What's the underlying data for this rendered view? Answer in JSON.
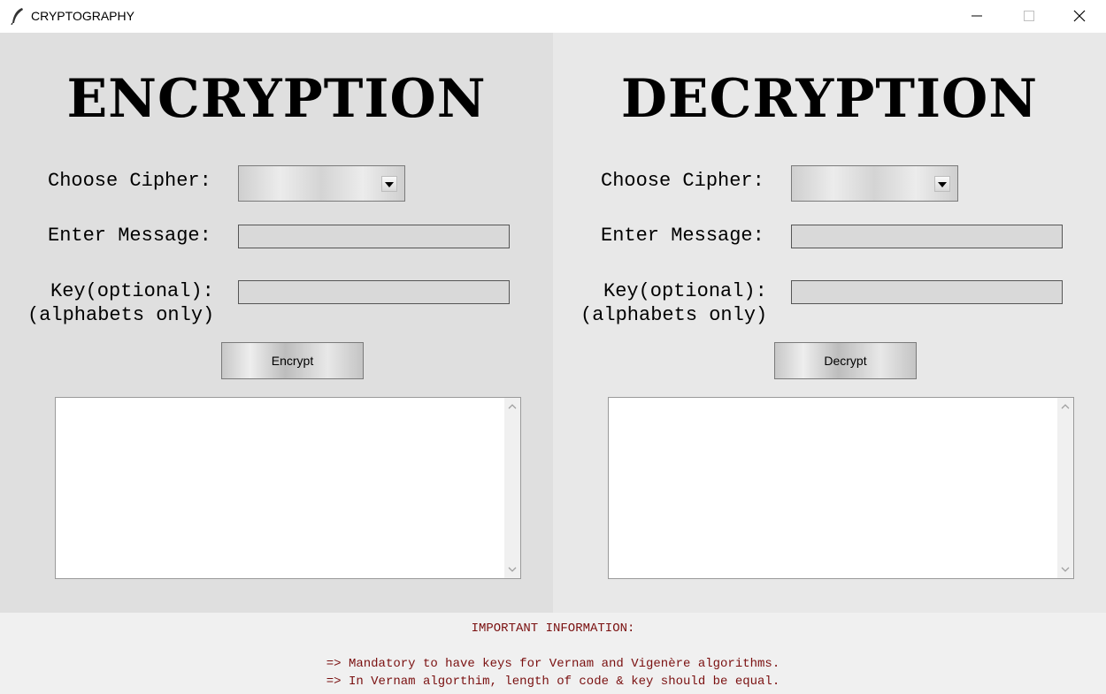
{
  "window": {
    "title": "CRYPTOGRAPHY",
    "icon": "feather-icon",
    "controls": [
      "minimize-icon",
      "maximize-icon",
      "close-icon"
    ]
  },
  "encryption": {
    "heading": "ENCRYPTION",
    "cipher_label": "Choose Cipher:",
    "cipher_value": "",
    "message_label": "Enter Message:",
    "message_value": "",
    "key_label": "Key(optional):",
    "key_hint": "(alphabets only)",
    "key_value": "",
    "button_label": "Encrypt",
    "output_text": ""
  },
  "decryption": {
    "heading": "DECRYPTION",
    "cipher_label": "Choose Cipher:",
    "cipher_value": "",
    "message_label": "Enter Message:",
    "message_value": "",
    "key_label": "Key(optional):",
    "key_hint": "(alphabets only)",
    "key_value": "",
    "button_label": "Decrypt",
    "output_text": ""
  },
  "info": {
    "title": "IMPORTANT INFORMATION:",
    "lines": [
      "=> Mandatory to have keys for Vernam and Vigenère algorithms.",
      "=> In Vernam algorthim, length of code & key should be equal."
    ]
  },
  "colors": {
    "left_panel": "#dfdfdf",
    "right_panel": "#e8e8e8",
    "info_text": "#7a1010"
  }
}
